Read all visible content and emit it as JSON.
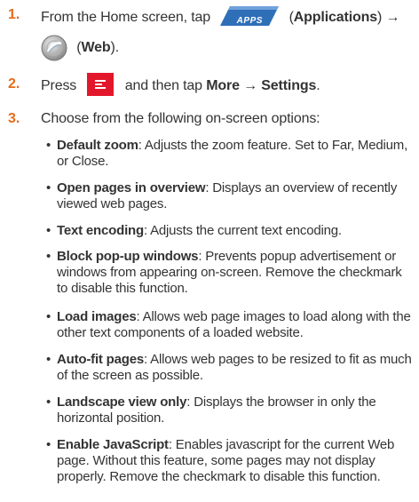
{
  "steps": [
    {
      "number": "1.",
      "text_before": "From the Home screen, tap",
      "apps_icon_label": "APPS",
      "apps_name": "Applications",
      "arrow": "→",
      "web_name": "Web",
      "closing": ").",
      "open_paren": "(",
      "close_paren": ")"
    },
    {
      "number": "2.",
      "text_before": "Press",
      "text_middle": "and then tap",
      "menu_path": "More → Settings",
      "end": "."
    },
    {
      "number": "3.",
      "text": "Choose from the following on-screen options:"
    }
  ],
  "options": [
    {
      "title": "Default zoom",
      "desc": ": Adjusts the zoom feature. Set to Far, Medium, or Close."
    },
    {
      "title": "Open pages in overview",
      "desc": ": Displays an overview of recently viewed web pages."
    },
    {
      "title": "Text encoding",
      "desc": ": Adjusts the current text encoding."
    },
    {
      "title": "Block pop-up windows",
      "desc": ": Prevents popup advertisement or windows from appearing on-screen. Remove the checkmark to disable this function."
    },
    {
      "title": "Load images",
      "desc": ": Allows web page images to load along with the other text components of a loaded website."
    },
    {
      "title": "Auto-fit pages",
      "desc": ": Allows web pages to be resized to fit as much of the screen as possible."
    },
    {
      "title": "Landscape view only",
      "desc": ": Displays the browser in only the horizontal position."
    },
    {
      "title": "Enable JavaScript",
      "desc": ": Enables javascript for the current Web page. Without this feature, some pages may not display properly. Remove the checkmark to disable this function."
    }
  ],
  "bullet": "•",
  "icons": {
    "apps": "apps-icon",
    "web": "web-globe-icon",
    "menu": "menu-key-icon"
  },
  "colors": {
    "step_number": "#e36d1e",
    "apps_icon": "#2f6fb8",
    "menu_key": "#e3172b"
  }
}
